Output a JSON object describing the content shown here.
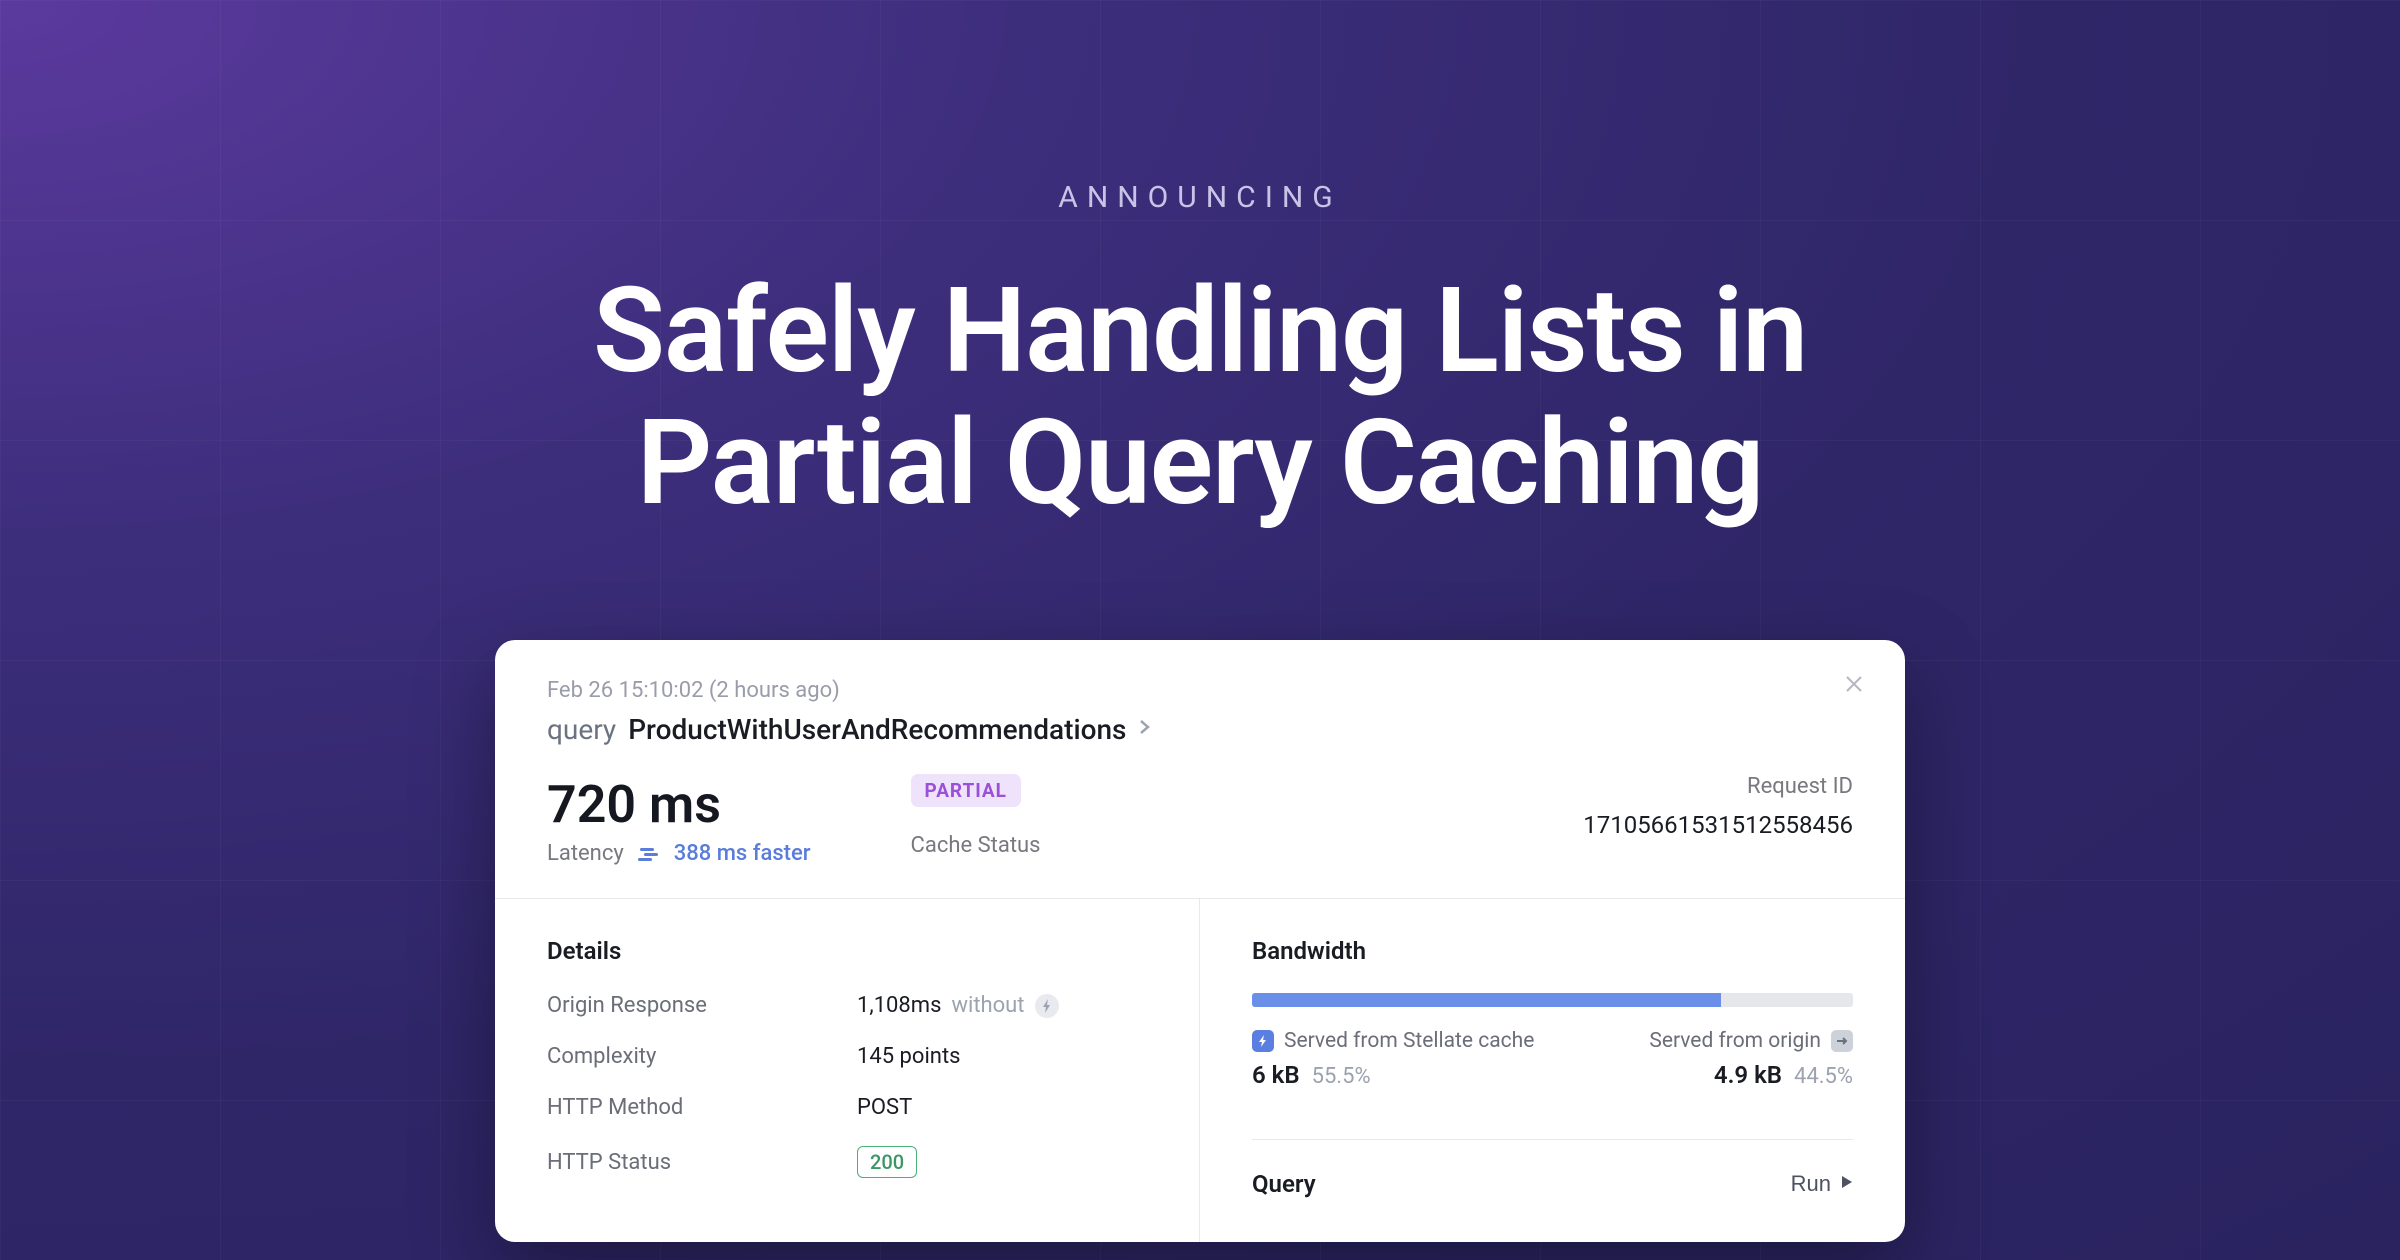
{
  "hero": {
    "kicker": "ANNOUNCING",
    "title_line1": "Safely Handling Lists in",
    "title_line2": "Partial Query Caching"
  },
  "card": {
    "timestamp": "Feb 26 15:10:02 (2 hours ago)",
    "query_prefix": "query",
    "query_name": "ProductWithUserAndRecommendations",
    "latency_value": "720 ms",
    "latency_label": "Latency",
    "latency_faster": "388 ms faster",
    "cache_badge": "PARTIAL",
    "cache_label": "Cache Status",
    "request_id_label": "Request ID",
    "request_id_value": "17105661531512558456"
  },
  "details": {
    "title": "Details",
    "rows": [
      {
        "label": "Origin Response",
        "value": "1,108ms",
        "suffix": "without",
        "icon": true
      },
      {
        "label": "Complexity",
        "value": "145 points"
      },
      {
        "label": "HTTP Method",
        "value": "POST"
      },
      {
        "label": "HTTP Status",
        "value": "200",
        "pill": true
      }
    ]
  },
  "bandwidth": {
    "title": "Bandwidth",
    "cached_label": "Served from Stellate cache",
    "cached_value": "6 kB",
    "cached_pct": "55.5%",
    "origin_label": "Served from origin",
    "origin_value": "4.9 kB",
    "origin_pct": "44.5%",
    "bar_pct": 78
  },
  "query_section": {
    "title": "Query",
    "run": "Run"
  }
}
